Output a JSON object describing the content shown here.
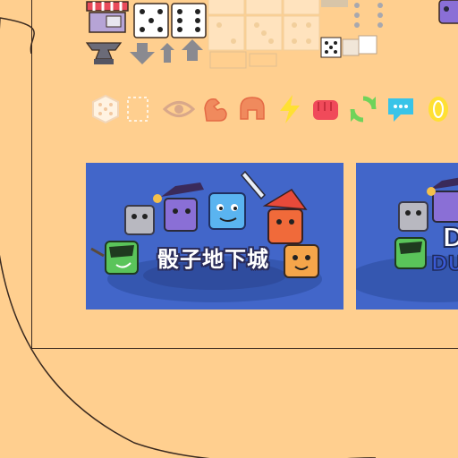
{
  "sprites": {
    "icons": [
      "shop-icon",
      "anvil-icon",
      "die-white-icon",
      "die-white-icon",
      "arrow-down-icon",
      "arrow-up-icon",
      "die-shadow-icon",
      "die-small-icon",
      "gray-dot-column-icon",
      "white-square-icon",
      "purple-character-icon"
    ],
    "sprite_label": "骰子地下城"
  },
  "icon_row": [
    {
      "name": "die-outline-icon",
      "color": "#fff3e2"
    },
    {
      "name": "empty-slot-icon",
      "color": "#fff3e2"
    },
    {
      "name": "eye-icon",
      "color": "#d9a88a"
    },
    {
      "name": "flex-arm-icon",
      "color": "#f08a5d"
    },
    {
      "name": "helmet-icon",
      "color": "#f08a5d"
    },
    {
      "name": "lightning-icon",
      "color": "#ffe033"
    },
    {
      "name": "fist-icon",
      "color": "#f04a5a"
    },
    {
      "name": "recycle-icon",
      "color": "#6fd35a"
    },
    {
      "name": "speech-bubble-icon",
      "color": "#39c4e8"
    },
    {
      "name": "coin-icon",
      "color": "#ffe033"
    }
  ],
  "banners": [
    {
      "title": "骰子地下城",
      "bg": "#4266c9"
    },
    {
      "title": "",
      "bg": "#4266c9"
    }
  ]
}
